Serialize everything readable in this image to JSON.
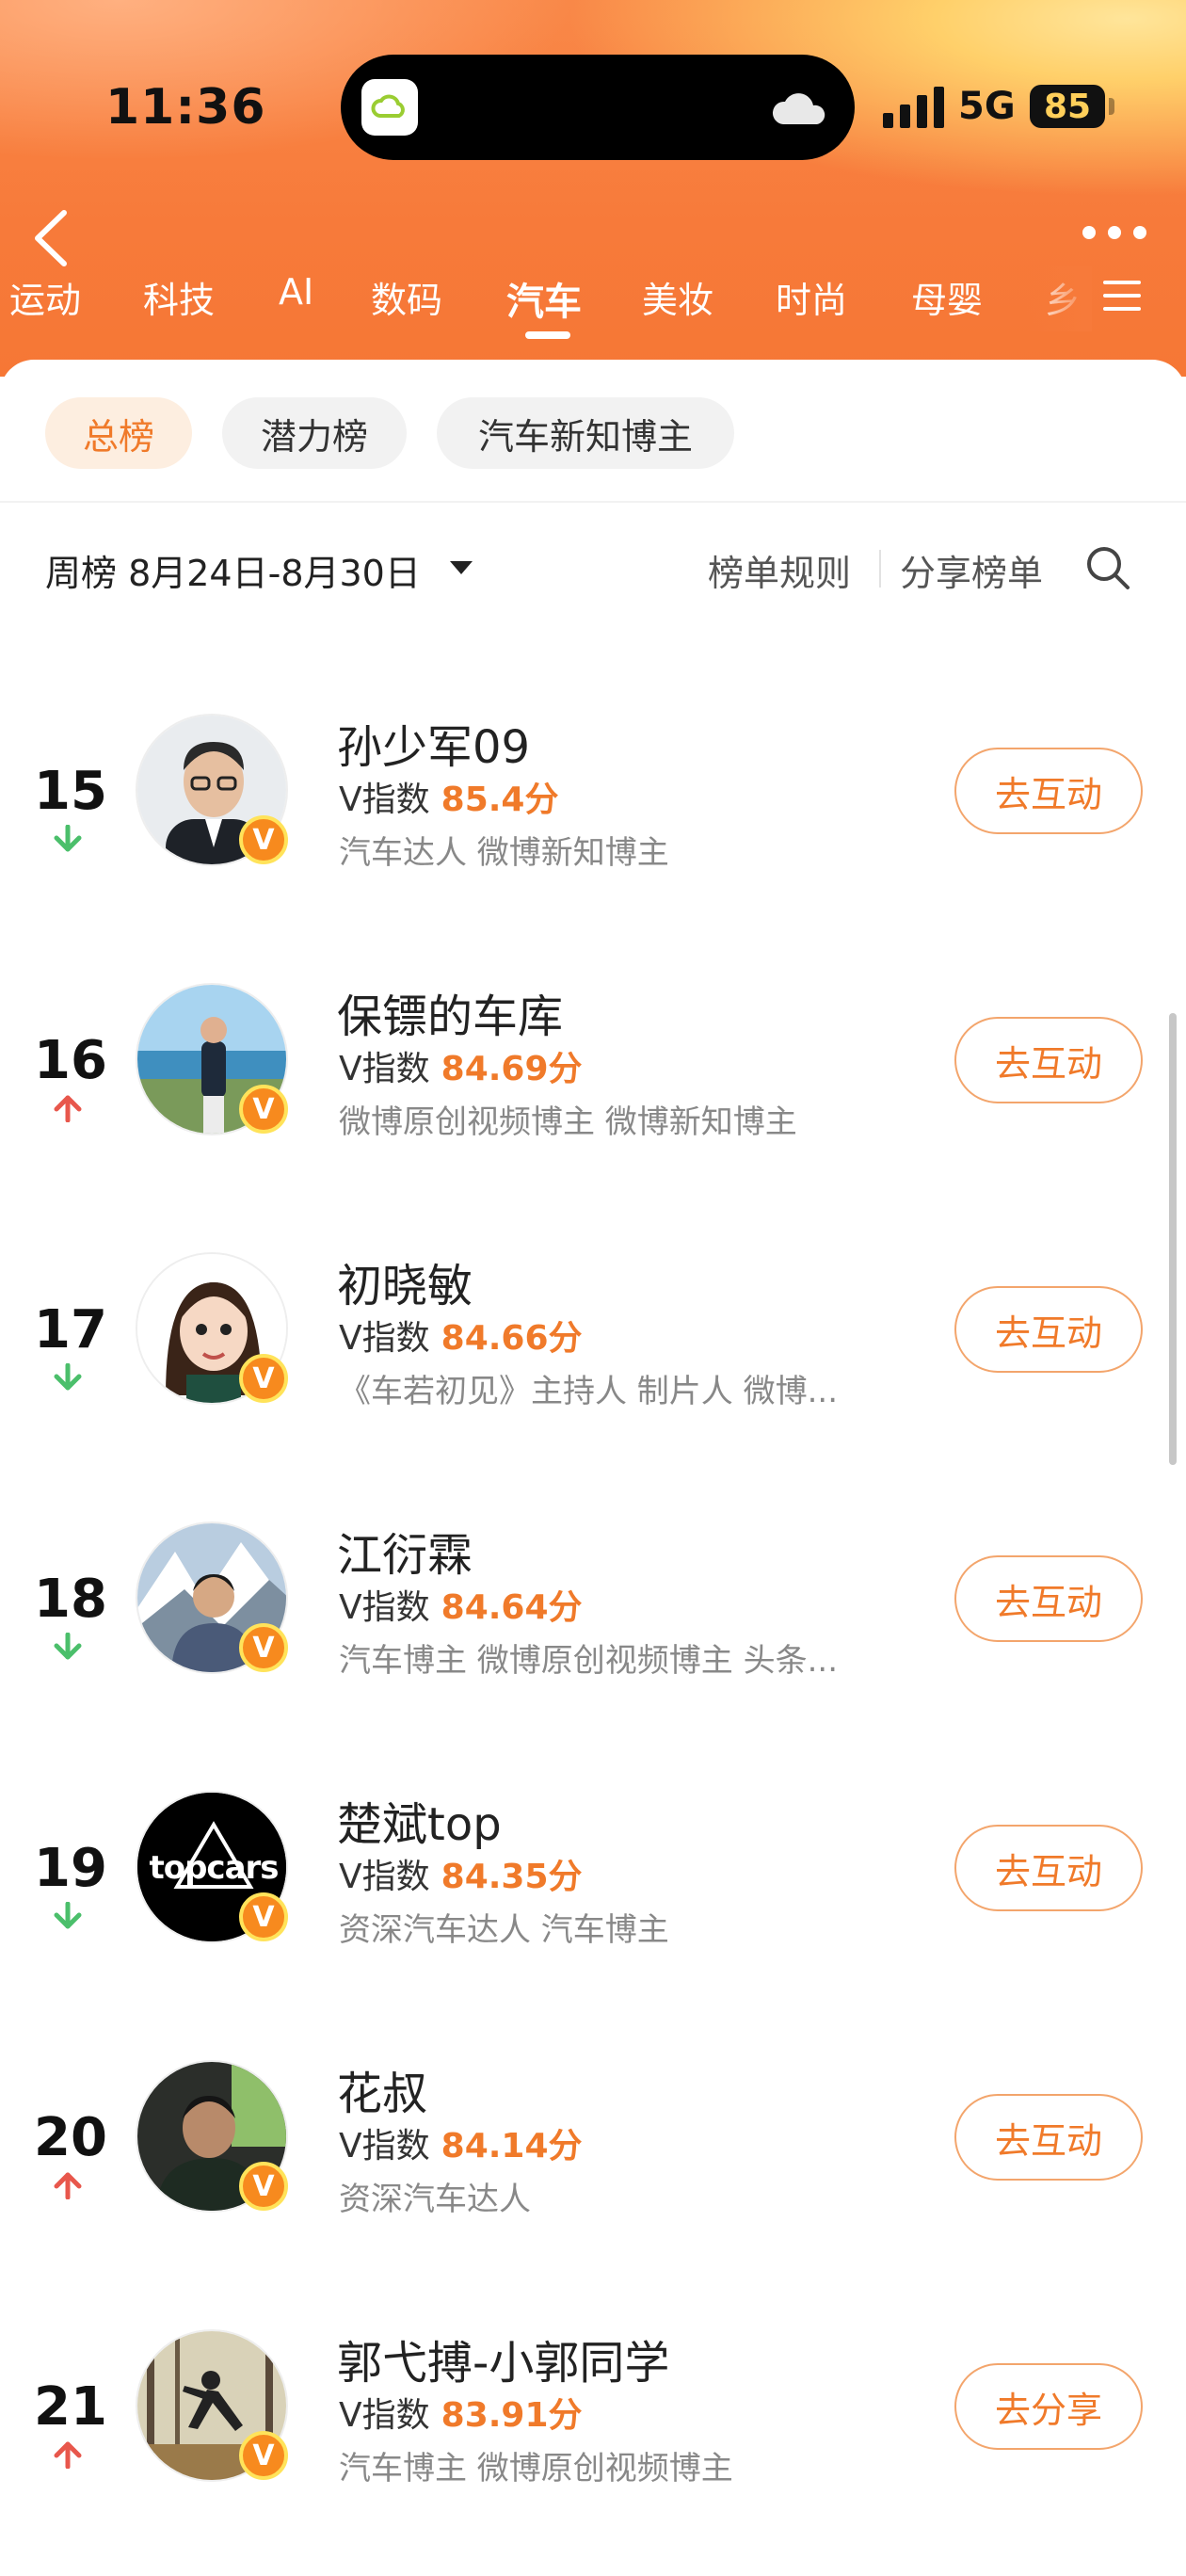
{
  "status_bar": {
    "time": "11:36",
    "network": "5G",
    "battery": "85"
  },
  "nav": {
    "tabs": [
      "运动",
      "科技",
      "AI",
      "数码",
      "汽车",
      "美妆",
      "时尚",
      "母婴",
      "乡"
    ],
    "active_tab": "汽车"
  },
  "filters": [
    "总榜",
    "潜力榜",
    "汽车新知博主"
  ],
  "active_filter": "总榜",
  "toolbar": {
    "week_label": "周榜 8月24日-8月30日",
    "rules": "榜单规则",
    "share": "分享榜单"
  },
  "list": [
    {
      "rank": "15",
      "trend": "down",
      "name": "孙少军09",
      "vidx_label": "V指数",
      "score": "85.4分",
      "tags": "汽车达人 微博新知博主",
      "action": "去互动"
    },
    {
      "rank": "16",
      "trend": "up",
      "name": "保镖的车库",
      "vidx_label": "V指数",
      "score": "84.69分",
      "tags": "微博原创视频博主 微博新知博主",
      "action": "去互动"
    },
    {
      "rank": "17",
      "trend": "down",
      "name": "初晓敏",
      "vidx_label": "V指数",
      "score": "84.66分",
      "tags": "《车若初见》主持人 制片人 微博...",
      "action": "去互动"
    },
    {
      "rank": "18",
      "trend": "down",
      "name": "江衍霖",
      "vidx_label": "V指数",
      "score": "84.64分",
      "tags": "汽车博主 微博原创视频博主 头条...",
      "action": "去互动"
    },
    {
      "rank": "19",
      "trend": "down",
      "name": "楚斌top",
      "vidx_label": "V指数",
      "score": "84.35分",
      "tags": "资深汽车达人 汽车博主",
      "action": "去互动"
    },
    {
      "rank": "20",
      "trend": "up",
      "name": "花叔",
      "vidx_label": "V指数",
      "score": "84.14分",
      "tags": "资深汽车达人",
      "action": "去互动"
    },
    {
      "rank": "21",
      "trend": "up",
      "name": "郭弋搏-小郭同学",
      "vidx_label": "V指数",
      "score": "83.91分",
      "tags": "汽车博主 微博原创视频博主",
      "action": "去分享"
    }
  ],
  "avatar_logo_text": "topcars",
  "verified_badge": "V",
  "colors": {
    "accent": "#f07a2a",
    "up": "#e8574c",
    "down": "#4bbf6b",
    "header": "#f77a3a"
  }
}
